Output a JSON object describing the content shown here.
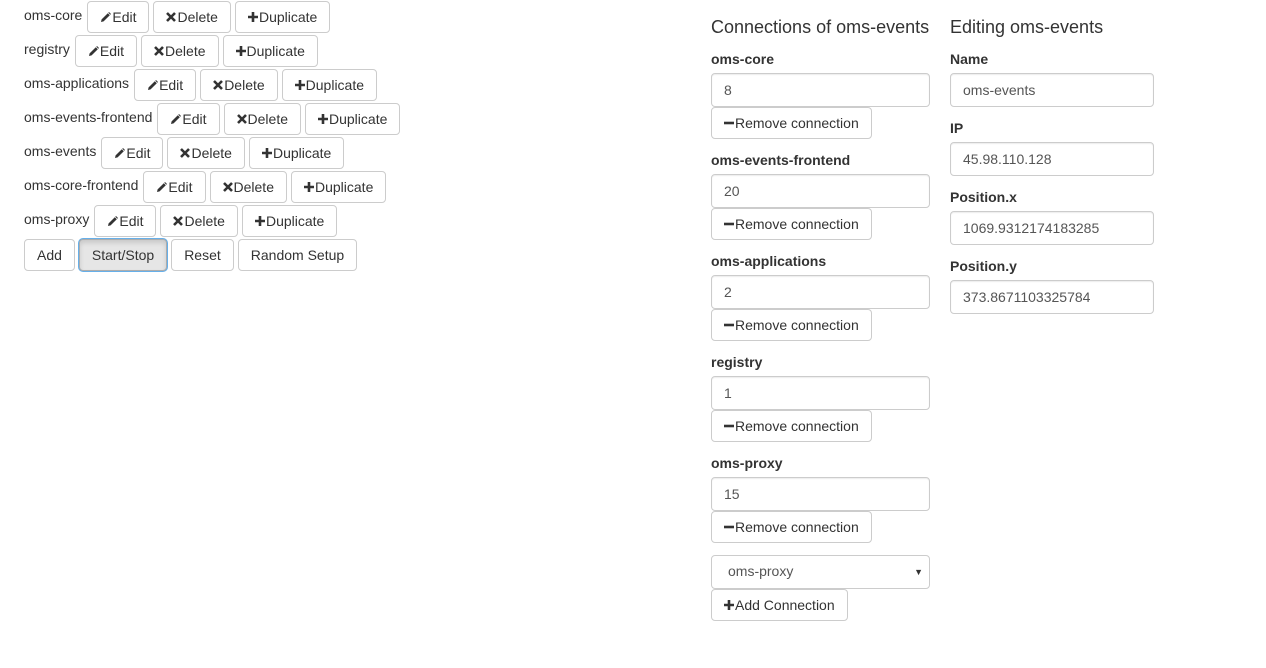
{
  "services": [
    {
      "name": "oms-core"
    },
    {
      "name": "registry"
    },
    {
      "name": "oms-applications"
    },
    {
      "name": "oms-events-frontend"
    },
    {
      "name": "oms-events"
    },
    {
      "name": "oms-core-frontend"
    },
    {
      "name": "oms-proxy"
    }
  ],
  "service_actions": {
    "edit_label": "Edit",
    "delete_label": "Delete",
    "duplicate_label": "Duplicate"
  },
  "controls": {
    "add_label": "Add",
    "start_stop_label": "Start/Stop",
    "reset_label": "Reset",
    "random_setup_label": "Random Setup"
  },
  "connections_panel": {
    "title": "Connections of oms-events",
    "remove_label": "Remove connection",
    "items": [
      {
        "name": "oms-core",
        "value": "8"
      },
      {
        "name": "oms-events-frontend",
        "value": "20"
      },
      {
        "name": "oms-applications",
        "value": "2"
      },
      {
        "name": "registry",
        "value": "1"
      },
      {
        "name": "oms-proxy",
        "value": "15"
      }
    ],
    "select_value": "oms-proxy",
    "add_connection_label": "Add Connection"
  },
  "editing_panel": {
    "title": "Editing oms-events",
    "name_label": "Name",
    "name_value": "oms-events",
    "ip_label": "IP",
    "ip_value": "45.98.110.128",
    "pos_x_label": "Position.x",
    "pos_x_value": "1069.9312174183285",
    "pos_y_label": "Position.y",
    "pos_y_value": "373.8671103325784"
  },
  "icons": {
    "edit": "pencil-icon",
    "delete": "x-icon",
    "duplicate": "plus-icon",
    "remove": "minus-icon",
    "add": "plus-icon",
    "select": "caret-down-icon"
  }
}
